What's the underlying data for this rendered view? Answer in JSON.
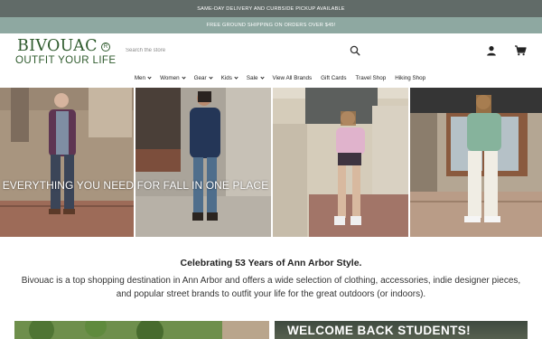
{
  "announcements": {
    "bar1": "SAME-DAY DELIVERY AND CURBSIDE PICKUP AVAILABLE",
    "bar2": "FREE GROUND SHIPPING ON ORDERS OVER $45!"
  },
  "header": {
    "logo_name": "BIVOUAC",
    "logo_reg": "R",
    "logo_tagline": "OUTFIT YOUR LIFE",
    "search_placeholder": "Search the store"
  },
  "nav": {
    "items": [
      {
        "label": "Men",
        "dropdown": true
      },
      {
        "label": "Women",
        "dropdown": true
      },
      {
        "label": "Gear",
        "dropdown": true
      },
      {
        "label": "Kids",
        "dropdown": true
      },
      {
        "label": "Sale",
        "dropdown": true
      },
      {
        "label": "View All Brands",
        "dropdown": false
      },
      {
        "label": "Gift Cards",
        "dropdown": false
      },
      {
        "label": "Travel Shop",
        "dropdown": false
      },
      {
        "label": "Hiking Shop",
        "dropdown": false
      }
    ]
  },
  "hero": {
    "caption": "EVERYTHING YOU NEED FOR FALL IN ONE PLACE"
  },
  "content": {
    "heading": "Celebrating 53 Years of Ann Arbor Style.",
    "intro": "Bivouac is a top shopping destination in Ann Arbor and offers a wide selection of clothing, accessories, indie designer pieces, and popular street brands to outfit your life for the great outdoors (or indoors)."
  },
  "promos": {
    "right_text": "WELCOME BACK STUDENTS!"
  },
  "colors": {
    "brand_green": "#2f5b2d",
    "bar1_bg": "#616b68",
    "bar2_bg": "#8ea8a1"
  },
  "icons": {
    "search": "search-icon",
    "account": "account-icon",
    "cart": "cart-icon"
  }
}
